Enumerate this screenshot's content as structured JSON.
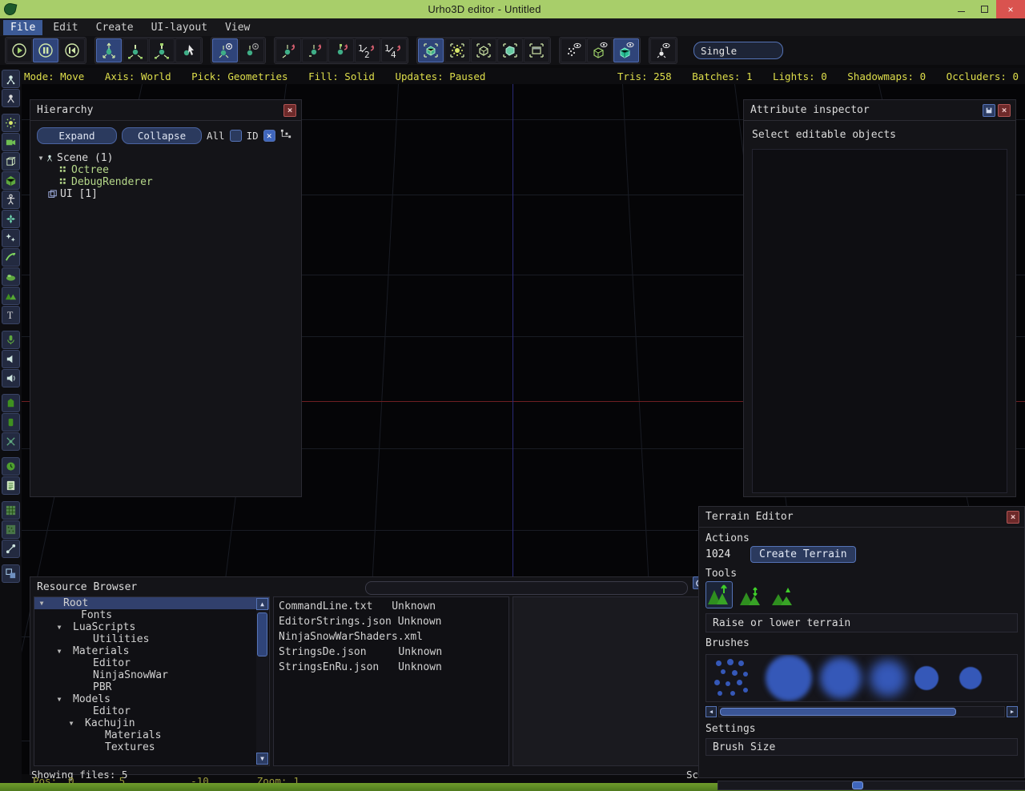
{
  "window": {
    "title": "Urho3D editor - Untitled",
    "logo_icon": "urho-leaf-icon",
    "minimize_label": "minimize-icon",
    "maximize_label": "maximize-icon",
    "close_label": "×"
  },
  "menu": {
    "items": [
      {
        "label": "File",
        "active": true
      },
      {
        "label": "Edit",
        "active": false
      },
      {
        "label": "Create",
        "active": false
      },
      {
        "label": "UI-layout",
        "active": false
      },
      {
        "label": "View",
        "active": false
      }
    ]
  },
  "toolbar": {
    "groups": [
      {
        "name": "playback",
        "buttons": [
          {
            "name": "run-update-play-button",
            "icon": "play-icon",
            "on": false
          },
          {
            "name": "run-update-pause-button",
            "icon": "pause-icon",
            "on": true
          },
          {
            "name": "revert-on-pause-button",
            "icon": "rewind-icon",
            "on": false
          }
        ]
      },
      {
        "name": "edit-mode",
        "buttons": [
          {
            "name": "edit-move-button",
            "icon": "axes-move-icon",
            "on": true
          },
          {
            "name": "edit-rotate-button",
            "icon": "axes-rotate-icon",
            "on": false
          },
          {
            "name": "edit-scale-button",
            "icon": "axes-scale-icon",
            "on": false
          },
          {
            "name": "edit-select-button",
            "icon": "axes-select-icon",
            "on": false
          }
        ]
      },
      {
        "name": "axis-mode",
        "buttons": [
          {
            "name": "axis-world-button",
            "icon": "axes-world-icon",
            "on": true
          },
          {
            "name": "axis-local-button",
            "icon": "axes-local-icon",
            "on": false
          }
        ]
      },
      {
        "name": "snap",
        "buttons": [
          {
            "name": "snap-move-button",
            "icon": "snap-move-icon",
            "on": false
          },
          {
            "name": "snap-rotate-button",
            "icon": "snap-rotate-icon",
            "on": false
          },
          {
            "name": "snap-scale-button",
            "icon": "snap-scale-icon",
            "on": false
          },
          {
            "name": "snap-half-button",
            "icon": "half-snap-icon",
            "on": false,
            "text": "1/2"
          },
          {
            "name": "snap-quarter-button",
            "icon": "quarter-snap-icon",
            "on": false,
            "text": "1/4"
          }
        ]
      },
      {
        "name": "pick-mode",
        "buttons": [
          {
            "name": "pick-geometries-button",
            "icon": "pick-geometry-icon",
            "on": true
          },
          {
            "name": "pick-lights-button",
            "icon": "pick-light-icon",
            "on": false
          },
          {
            "name": "pick-zones-button",
            "icon": "pick-zone-icon",
            "on": false
          },
          {
            "name": "pick-rigidbodies-button",
            "icon": "pick-rigidbody-icon",
            "on": false
          },
          {
            "name": "pick-uielements-button",
            "icon": "pick-ui-icon",
            "on": false
          }
        ]
      },
      {
        "name": "fill-mode",
        "buttons": [
          {
            "name": "fill-point-button",
            "icon": "fill-point-icon",
            "on": false
          },
          {
            "name": "fill-wireframe-button",
            "icon": "fill-wireframe-icon",
            "on": false
          },
          {
            "name": "fill-solid-button",
            "icon": "fill-solid-icon",
            "on": true
          }
        ]
      },
      {
        "name": "debug",
        "buttons": [
          {
            "name": "toggle-rendering-debug-button",
            "icon": "debug-render-icon",
            "on": false
          }
        ]
      }
    ],
    "layout_field": {
      "name": "viewport-layout-field",
      "value": "Single"
    }
  },
  "stats": {
    "left": [
      {
        "key": "Mode:",
        "value": "Move"
      },
      {
        "key": "Axis:",
        "value": "World"
      },
      {
        "key": "Pick:",
        "value": "Geometries"
      },
      {
        "key": "Fill:",
        "value": "Solid"
      },
      {
        "key": "Updates:",
        "value": "Paused"
      }
    ],
    "right": [
      {
        "key": "Tris:",
        "value": "258"
      },
      {
        "key": "Batches:",
        "value": "1"
      },
      {
        "key": "Lights:",
        "value": "0"
      },
      {
        "key": "Shadowmaps:",
        "value": "0"
      },
      {
        "key": "Occluders:",
        "value": "0"
      }
    ]
  },
  "rail": {
    "items": [
      {
        "name": "rail-create-node-replicated",
        "icon": "node-icon"
      },
      {
        "name": "rail-create-node-local",
        "icon": "node-local-icon"
      },
      {
        "name": "rail-create-light",
        "icon": "light-icon"
      },
      {
        "name": "rail-create-camera",
        "icon": "camera-icon"
      },
      {
        "name": "rail-create-staticmodel",
        "icon": "box-icon"
      },
      {
        "name": "rail-create-animatedmodel",
        "icon": "animated-model-icon"
      },
      {
        "name": "rail-create-skeleton",
        "icon": "skeleton-icon"
      },
      {
        "name": "rail-create-particle",
        "icon": "particle-emitter-icon"
      },
      {
        "name": "rail-create-billboard",
        "icon": "billboard-icon"
      },
      {
        "name": "rail-create-ribbon",
        "icon": "ribbon-trail-icon"
      },
      {
        "name": "rail-create-water",
        "icon": "water-icon"
      },
      {
        "name": "rail-create-terrain",
        "icon": "terrain-icon"
      },
      {
        "name": "rail-create-text3d",
        "icon": "text3d-icon"
      },
      {
        "name": "rail-create-soundsource",
        "icon": "sound-source-icon"
      },
      {
        "name": "rail-create-soundlistener",
        "icon": "sound-listener-icon"
      },
      {
        "name": "rail-create-soundlistener2",
        "icon": "sound-listener2-icon"
      },
      {
        "name": "rail-create-rigidbody",
        "icon": "rigidbody-icon"
      },
      {
        "name": "rail-create-collisionshape",
        "icon": "collision-shape-icon"
      },
      {
        "name": "rail-create-constraint",
        "icon": "constraint-icon"
      },
      {
        "name": "rail-create-navigable",
        "icon": "navigable-icon"
      },
      {
        "name": "rail-create-script",
        "icon": "script-icon"
      },
      {
        "name": "rail-create-navmesh",
        "icon": "navmesh-icon"
      },
      {
        "name": "rail-create-crowdmanager",
        "icon": "crowd-manager-icon"
      },
      {
        "name": "rail-create-offmeshconnection",
        "icon": "offmesh-connection-icon"
      },
      {
        "name": "rail-create-decalset",
        "icon": "decal-set-icon"
      }
    ]
  },
  "hierarchy": {
    "title": "Hierarchy",
    "close_label": "×",
    "expand_label": "Expand",
    "collapse_label": "Collapse",
    "all_label": "All",
    "id_label": "ID",
    "id_checked": true,
    "all_checked": false,
    "id_check_glyph": "✕",
    "show_hierarchy_icon": "hierarchy-tree-icon",
    "tree": [
      {
        "label": "Scene (1)",
        "indent": 0,
        "expander": "▼",
        "icon": "scene-icon",
        "color": "#dcdcdc"
      },
      {
        "label": "Octree",
        "indent": 1,
        "expander": "",
        "icon": "component-icon",
        "color": "#b6d98a"
      },
      {
        "label": "DebugRenderer",
        "indent": 1,
        "expander": "",
        "icon": "component-icon",
        "color": "#b6d98a"
      },
      {
        "label": "UI [1]",
        "indent": 0,
        "expander": "",
        "icon": "ui-icon",
        "color": "#dcdcdc"
      }
    ]
  },
  "attribute_inspector": {
    "title": "Attribute inspector",
    "pin_label": "▣",
    "close_label": "×",
    "message": "Select editable objects"
  },
  "resource_browser": {
    "title": "Resource Browser",
    "search_placeholder": "",
    "search_value": "",
    "refresh_icon": "refresh-icon",
    "filter_icon": "filter-icon",
    "clear_icon": "clear-icon",
    "tree": [
      {
        "label": "Root",
        "indent": 0,
        "expander": "▼",
        "selected": true
      },
      {
        "label": "Fonts",
        "indent": 1,
        "expander": "",
        "selected": false
      },
      {
        "label": "LuaScripts",
        "indent": 1,
        "expander": "▼",
        "selected": false
      },
      {
        "label": "Utilities",
        "indent": 2,
        "expander": "",
        "selected": false
      },
      {
        "label": "Materials",
        "indent": 1,
        "expander": "▼",
        "selected": false
      },
      {
        "label": "Editor",
        "indent": 2,
        "expander": "",
        "selected": false
      },
      {
        "label": "NinjaSnowWar",
        "indent": 2,
        "expander": "",
        "selected": false
      },
      {
        "label": "PBR",
        "indent": 2,
        "expander": "",
        "selected": false
      },
      {
        "label": "Models",
        "indent": 1,
        "expander": "▼",
        "selected": false
      },
      {
        "label": "Editor",
        "indent": 2,
        "expander": "",
        "selected": false
      },
      {
        "label": "Kachujin",
        "indent": 2,
        "expander": "▼",
        "selected": false
      },
      {
        "label": "Materials",
        "indent": 3,
        "expander": "",
        "selected": false
      },
      {
        "label": "Textures",
        "indent": 3,
        "expander": "",
        "selected": false
      }
    ],
    "files": [
      {
        "name": "CommandLine.txt",
        "kind": "Unknown"
      },
      {
        "name": "EditorStrings.json",
        "kind": "Unknown"
      },
      {
        "name": "NinjaSnowWarShaders.xml",
        "kind": ""
      },
      {
        "name": "StringsDe.json",
        "kind": "Unknown"
      },
      {
        "name": "StringsEnRu.json",
        "kind": "Unknown"
      }
    ],
    "scroll_up_glyph": "▲",
    "scroll_down_glyph": "▼"
  },
  "terrain_editor": {
    "title": "Terrain Editor",
    "close_label": "×",
    "actions_label": "Actions",
    "size_value": "1024",
    "create_terrain_label": "Create Terrain",
    "tools_label": "Tools",
    "tools": [
      {
        "name": "terrain-tool-raise-lower",
        "icon": "terrain-raise-lower-icon",
        "selected": true
      },
      {
        "name": "terrain-tool-smooth",
        "icon": "terrain-smooth-icon",
        "selected": false
      },
      {
        "name": "terrain-tool-level",
        "icon": "terrain-level-icon",
        "selected": false
      }
    ],
    "tool_description": "Raise or lower terrain",
    "brushes_label": "Brushes",
    "brushes": [
      {
        "name": "brush-scatter",
        "type": "scatter",
        "size": 0
      },
      {
        "name": "brush-soft-large",
        "type": "circle",
        "size": 58,
        "blur": 7
      },
      {
        "name": "brush-soft-medium",
        "type": "circle",
        "size": 50,
        "blur": 9
      },
      {
        "name": "brush-soft-small",
        "type": "circle",
        "size": 44,
        "blur": 11
      },
      {
        "name": "brush-hard-small",
        "type": "circle",
        "size": 30,
        "blur": 1
      },
      {
        "name": "brush-hard-tiny",
        "type": "circle",
        "size": 28,
        "blur": 1
      }
    ],
    "settings_label": "Settings",
    "brush_size_label": "Brush Size",
    "scroll_left_glyph": "◀",
    "scroll_right_glyph": "▶"
  },
  "statusbar": {
    "showing_files": "Showing files: 5",
    "scan_text": "Scan co",
    "pos_label": "Pos:",
    "pos_x": "0",
    "pos_y": "5",
    "pos_z": "-10",
    "zoom_label": "Zoom:",
    "zoom_value": "1"
  },
  "colors": {
    "title_bar": "#a8ce6a",
    "accent_blue": "#3f66bd",
    "panel_bg": "#141418",
    "stats_yellow": "#dede4b",
    "tree_component_green": "#b6d98a",
    "close_red": "#d9534f"
  }
}
